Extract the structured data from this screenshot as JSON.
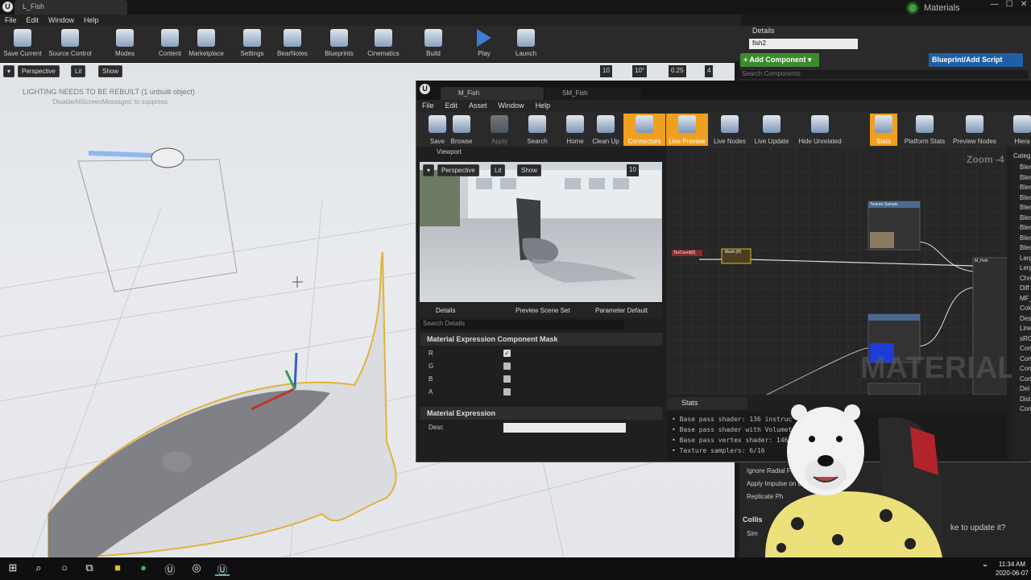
{
  "window": {
    "tab": "L_Fish",
    "menu": [
      "File",
      "Edit",
      "Window",
      "Help"
    ],
    "badge": "Materials",
    "controls": [
      "—",
      "☐",
      "✕"
    ]
  },
  "toolbar": [
    {
      "label": "Save Current",
      "icon": "save-icon"
    },
    {
      "label": "Source Control",
      "icon": "source-control-icon"
    },
    {
      "label": "Modes",
      "icon": "modes-icon"
    },
    {
      "label": "Content",
      "icon": "content-icon"
    },
    {
      "label": "Marketplace",
      "icon": "marketplace-icon"
    },
    {
      "label": "Settings",
      "icon": "settings-icon"
    },
    {
      "label": "BearNotes",
      "icon": "notes-icon"
    },
    {
      "label": "Blueprints",
      "icon": "blueprints-icon"
    },
    {
      "label": "Cinematics",
      "icon": "cinematics-icon"
    },
    {
      "label": "Build",
      "icon": "build-icon"
    },
    {
      "label": "Play",
      "icon": "play-icon"
    },
    {
      "label": "Launch",
      "icon": "launch-icon"
    }
  ],
  "viewport": {
    "perspective": "Perspective",
    "lit": "Lit",
    "show": "Show",
    "grid_snap": "10",
    "rot_snap": "10°",
    "scale_snap": "0.25",
    "cam_speed": "4",
    "lighting_msg": "LIGHTING NEEDS TO BE REBUILT (1 unbuilt object)",
    "lighting_sub": "'DisableAllScreenMessages' to suppress"
  },
  "details": {
    "tab": "Details",
    "search_value": "fish2",
    "add_component": "+ Add Component ▾",
    "blueprint_button": "Blueprint/Add Script",
    "search_components_placeholder": "Search Components",
    "lower_items": [
      "Ignore Radial Force",
      "Apply Impulse on D",
      "Replicate Ph"
    ],
    "collision": "Collis",
    "sim": "Sim",
    "update_text": "ke to update it?"
  },
  "material_editor": {
    "tabs": [
      "M_Fish",
      "SM_Fish"
    ],
    "menu": [
      "File",
      "Edit",
      "Asset",
      "Window",
      "Help"
    ],
    "tools": [
      {
        "label": "Save",
        "on": false
      },
      {
        "label": "Browse",
        "on": false
      },
      {
        "label": "Apply",
        "on": false
      },
      {
        "label": "Search",
        "on": false
      },
      {
        "label": "Home",
        "on": false
      },
      {
        "label": "Clean Up",
        "on": false
      },
      {
        "label": "Connectors",
        "on": true
      },
      {
        "label": "Live Preview",
        "on": true
      },
      {
        "label": "Live Nodes",
        "on": false
      },
      {
        "label": "Live Update",
        "on": false
      },
      {
        "label": "Hide Unrelated",
        "on": false
      },
      {
        "label": "Stats",
        "on": true
      },
      {
        "label": "Platform Stats",
        "on": false
      },
      {
        "label": "Preview Nodes",
        "on": false
      },
      {
        "label": "Hiera",
        "on": false
      }
    ],
    "viewport_tab": "Viewport",
    "preview": {
      "perspective": "Perspective",
      "lit": "Lit",
      "show": "Show",
      "snap": "10"
    },
    "detail_tabs": [
      "Details",
      "Preview Scene Set",
      "Parameter Default"
    ],
    "search_placeholder": "Search Details",
    "section1": "Material Expression Component Mask",
    "channels": [
      {
        "name": "R",
        "checked": true
      },
      {
        "name": "G",
        "checked": false
      },
      {
        "name": "B",
        "checked": false
      },
      {
        "name": "A",
        "checked": false
      }
    ],
    "section2": "Material Expression",
    "desc_label": "Desc",
    "graph": {
      "zoom": "Zoom -4",
      "watermark": "MATERIAL",
      "nodes": [
        "Texture Sample",
        "Mask (R)",
        "TexCoord[0]",
        "M_Fish"
      ]
    },
    "stats_tab": "Stats",
    "stats": [
      "Base pass shader: 136 instruc",
      "Base pass shader with Volumet",
      "Base pass vertex shader: 146",
      "Texture samplers: 6/16"
    ],
    "palette_header": "Categ",
    "palette": [
      "Blen",
      "Blen",
      "Blen",
      "Blen",
      "Blen",
      "Blen",
      "Blen",
      "Blen",
      "Blen",
      "Lerp",
      "Lerp",
      "Chro",
      "Diff",
      "MF_",
      "Colo",
      "Des",
      "Line",
      "sRG",
      "Con",
      "Con",
      "Con",
      "Con",
      "Del",
      "Dist",
      "Con"
    ]
  },
  "taskbar": {
    "time": "11:34 AM",
    "date": "2020-06-07"
  }
}
